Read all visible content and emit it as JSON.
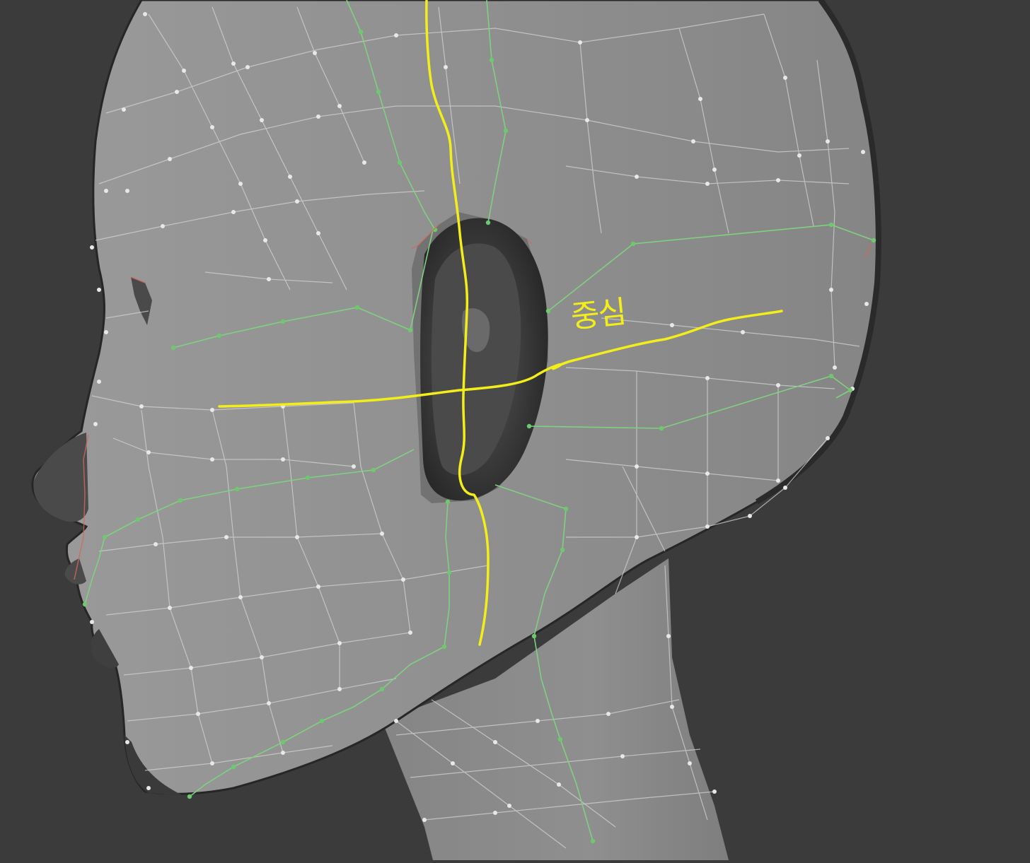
{
  "scene": {
    "background": "#3b3b3b",
    "mesh_color": "#8c8c8c",
    "wire_color": "#d4d4d4",
    "seam_color": "#7fd17f",
    "edge_color": "#d06a5a",
    "ear_color": "#2e2e2e",
    "annotation_color": "#f3ee1a"
  },
  "annotation": {
    "label": "중심"
  }
}
